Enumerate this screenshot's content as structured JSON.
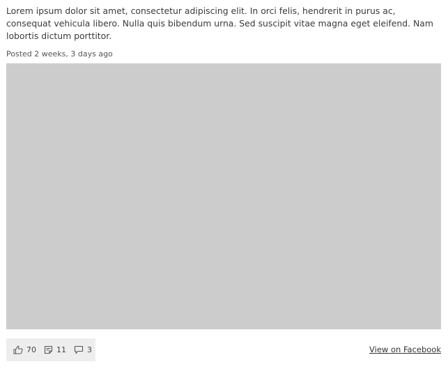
{
  "post": {
    "text": "Lorem ipsum dolor sit amet, consectetur adipiscing elit. In orci felis, hendrerit in purus ac, consequat vehicula libero. Nulla quis bibendum urna. Sed suscipit vitae magna eget eleifend. Nam lobortis dictum porttitor.",
    "posted": "Posted 2 weeks, 3 days ago"
  },
  "stats": {
    "likes": {
      "icon": "thumbs-up-icon",
      "count": "70"
    },
    "shares": {
      "icon": "document-icon",
      "count": "11"
    },
    "comments": {
      "icon": "comment-icon",
      "count": "3"
    }
  },
  "footer": {
    "view_link": "View on Facebook"
  },
  "colors": {
    "media_placeholder": "#cccccc",
    "stats_background": "#eeeeee"
  }
}
